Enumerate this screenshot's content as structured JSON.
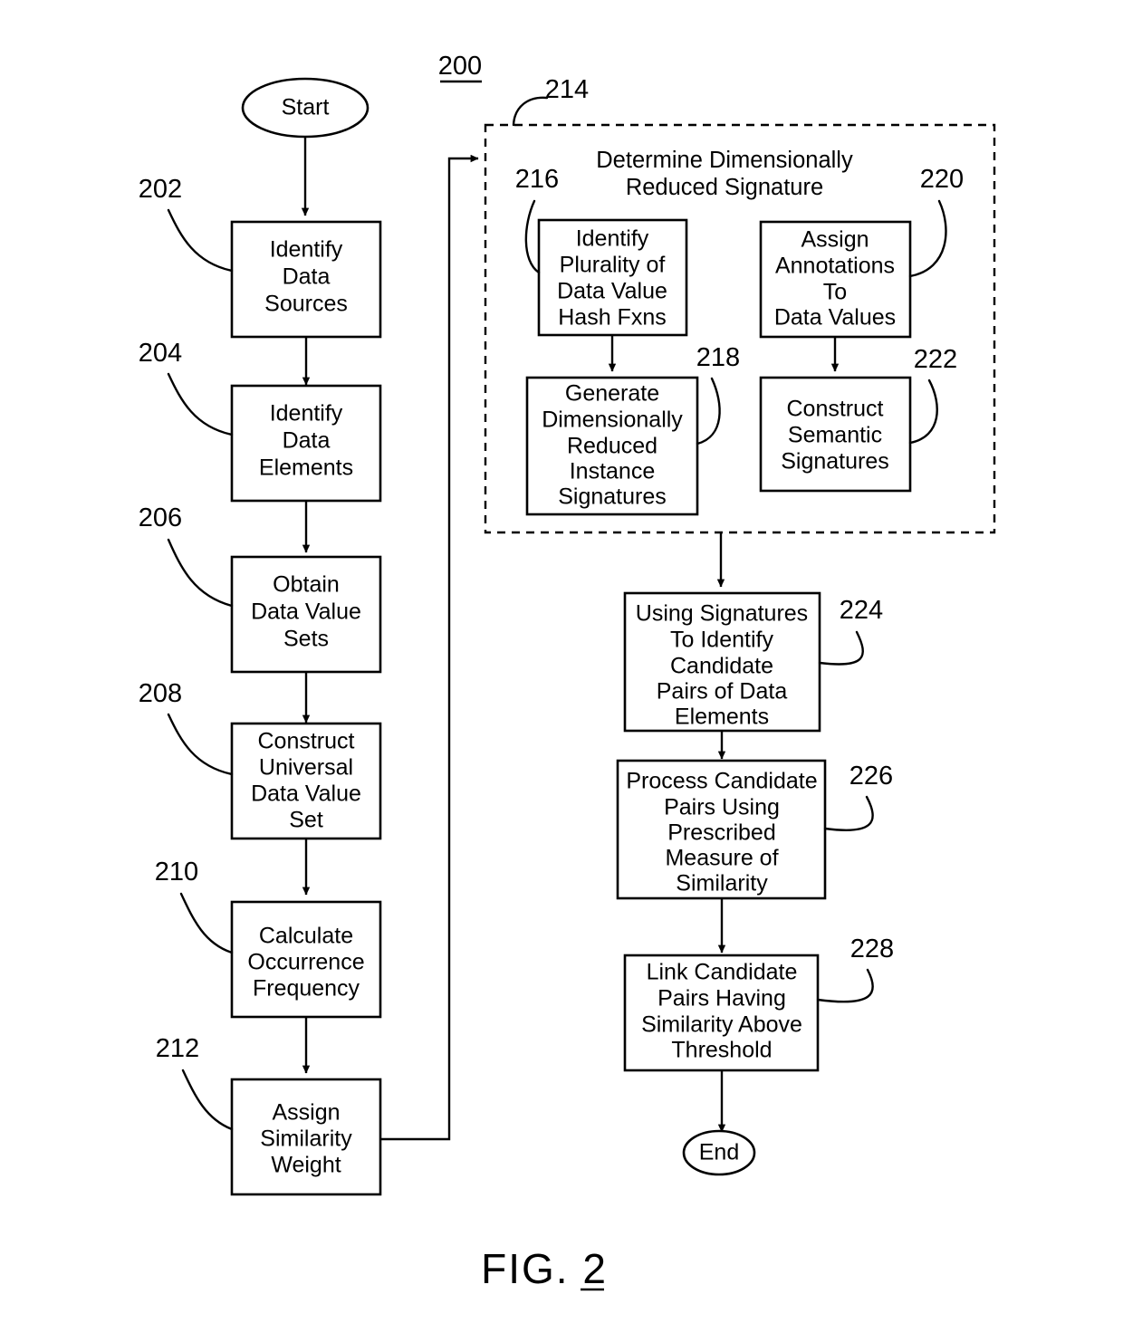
{
  "figure": {
    "label": "FIG. 2",
    "diagram_ref": "200"
  },
  "terminators": {
    "start": "Start",
    "end": "End"
  },
  "left_column": [
    {
      "ref": "202",
      "lines": [
        "Identify",
        "Data",
        "Sources"
      ]
    },
    {
      "ref": "204",
      "lines": [
        "Identify",
        "Data",
        "Elements"
      ]
    },
    {
      "ref": "206",
      "lines": [
        "Obtain",
        "Data Value",
        "Sets"
      ]
    },
    {
      "ref": "208",
      "lines": [
        "Construct",
        "Universal",
        "Data Value",
        "Set"
      ]
    },
    {
      "ref": "210",
      "lines": [
        "Calculate",
        "Occurrence",
        "Frequency"
      ]
    },
    {
      "ref": "212",
      "lines": [
        "Assign",
        "Similarity",
        "Weight"
      ]
    }
  ],
  "group": {
    "ref": "214",
    "title_lines": [
      "Determine Dimensionally",
      "Reduced Signature"
    ],
    "children": [
      {
        "ref": "216",
        "lines": [
          "Identify",
          "Plurality of",
          "Data Value",
          "Hash Fxns"
        ]
      },
      {
        "ref": "218",
        "lines": [
          "Generate",
          "Dimensionally",
          "Reduced",
          "Instance",
          "Signatures"
        ]
      },
      {
        "ref": "220",
        "lines": [
          "Assign",
          "Annotations",
          "To",
          "Data Values"
        ]
      },
      {
        "ref": "222",
        "lines": [
          "Construct",
          "Semantic",
          "Signatures"
        ]
      }
    ]
  },
  "right_column": [
    {
      "ref": "224",
      "lines": [
        "Using Signatures",
        "To Identify",
        "Candidate",
        "Pairs of Data",
        "Elements"
      ]
    },
    {
      "ref": "226",
      "lines": [
        "Process Candidate",
        "Pairs Using",
        "Prescribed",
        "Measure of",
        "Similarity"
      ]
    },
    {
      "ref": "228",
      "lines": [
        "Link Candidate",
        "Pairs Having",
        "Similarity Above",
        "Threshold"
      ]
    }
  ]
}
